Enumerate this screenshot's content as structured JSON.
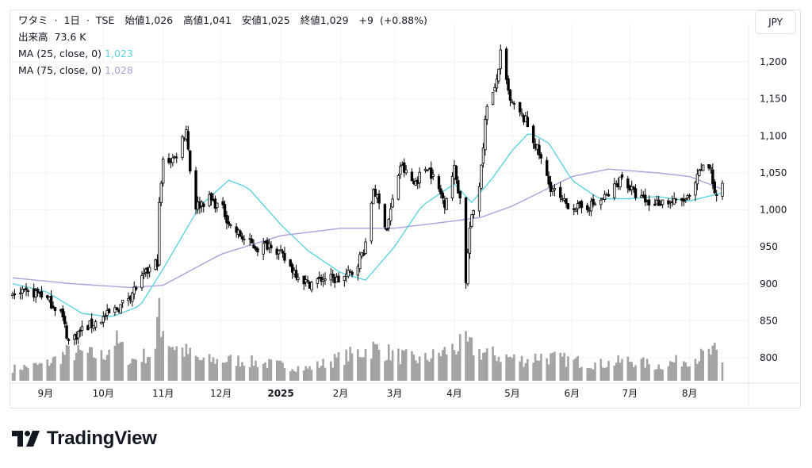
{
  "legend": {
    "name": "ワタミ",
    "interval": "1日",
    "exchange": "TSE",
    "sep": "·",
    "open_label": "始値",
    "open": "1,026",
    "high_label": "高値",
    "high": "1,041",
    "low_label": "安値",
    "low": "1,025",
    "close_label": "終値",
    "close": "1,029",
    "change": "+9",
    "change_pct": "(+0.88%)",
    "volume_label": "出来高",
    "volume": "73.6 K",
    "ma1_label": "MA (25, close, 0)",
    "ma1_value": "1,023",
    "ma2_label": "MA (75, close, 0)",
    "ma2_value": "1,028"
  },
  "currency": "JPY",
  "brand": "TradingView",
  "colors": {
    "up": "#ffffff",
    "down": "#000000",
    "wick": "#000000",
    "ma1": "#5fd3df",
    "ma2": "#b39ddb",
    "volume": "#a3a3a3",
    "grid": "#f2f3f5",
    "text": "#131722",
    "border": "#e0e3eb"
  },
  "chart_data": {
    "type": "candlestick",
    "title": "ワタミ · 1日 · TSE",
    "x_range": [
      "2024-08-15",
      "2025-08-18"
    ],
    "ylim": [
      775,
      1235
    ],
    "y_ticks": [
      800,
      850,
      900,
      950,
      1000,
      1050,
      1100,
      1150,
      1200
    ],
    "y_tick_labels": [
      "800",
      "850",
      "900",
      "950",
      "1,000",
      "1,050",
      "1,100",
      "1,150",
      "1,200"
    ],
    "x_ticks": [
      {
        "date": "2024-09-01",
        "label": "9月"
      },
      {
        "date": "2024-10-01",
        "label": "10月"
      },
      {
        "date": "2024-11-01",
        "label": "11月"
      },
      {
        "date": "2024-12-01",
        "label": "12月"
      },
      {
        "date": "2025-01-01",
        "label": "2025"
      },
      {
        "date": "2025-02-01",
        "label": "2月"
      },
      {
        "date": "2025-03-01",
        "label": "3月"
      },
      {
        "date": "2025-04-01",
        "label": "4月"
      },
      {
        "date": "2025-05-01",
        "label": "5月"
      },
      {
        "date": "2025-06-01",
        "label": "6月"
      },
      {
        "date": "2025-07-01",
        "label": "7月"
      },
      {
        "date": "2025-08-01",
        "label": "8月"
      }
    ],
    "close_anchors": [
      [
        "2024-08-15",
        885
      ],
      [
        "2024-08-29",
        888
      ],
      [
        "2024-09-09",
        862
      ],
      [
        "2024-09-13",
        822
      ],
      [
        "2024-09-20",
        838
      ],
      [
        "2024-09-30",
        852
      ],
      [
        "2024-10-10",
        870
      ],
      [
        "2024-10-18",
        895
      ],
      [
        "2024-10-25",
        920
      ],
      [
        "2024-10-29",
        930
      ],
      [
        "2024-10-30",
        1005
      ],
      [
        "2024-11-01",
        1065
      ],
      [
        "2024-11-07",
        1070
      ],
      [
        "2024-11-13",
        1110
      ],
      [
        "2024-11-15",
        1055
      ],
      [
        "2024-11-18",
        1005
      ],
      [
        "2024-11-25",
        1015
      ],
      [
        "2024-12-02",
        1000
      ],
      [
        "2024-12-06",
        978
      ],
      [
        "2024-12-13",
        960
      ],
      [
        "2024-12-20",
        948
      ],
      [
        "2024-12-27",
        955
      ],
      [
        "2025-01-07",
        920
      ],
      [
        "2025-01-15",
        900
      ],
      [
        "2025-01-24",
        908
      ],
      [
        "2025-01-31",
        905
      ],
      [
        "2025-02-07",
        915
      ],
      [
        "2025-02-14",
        950
      ],
      [
        "2025-02-18",
        1030
      ],
      [
        "2025-02-25",
        975
      ],
      [
        "2025-03-04",
        1060
      ],
      [
        "2025-03-11",
        1035
      ],
      [
        "2025-03-18",
        1060
      ],
      [
        "2025-03-27",
        1010
      ],
      [
        "2025-04-01",
        1055
      ],
      [
        "2025-04-04",
        1015
      ],
      [
        "2025-04-07",
        905
      ],
      [
        "2025-04-09",
        975
      ],
      [
        "2025-04-14",
        1035
      ],
      [
        "2025-04-18",
        1145
      ],
      [
        "2025-04-22",
        1160
      ],
      [
        "2025-04-25",
        1210
      ],
      [
        "2025-04-30",
        1145
      ],
      [
        "2025-05-08",
        1120
      ],
      [
        "2025-05-15",
        1075
      ],
      [
        "2025-05-20",
        1035
      ],
      [
        "2025-05-27",
        1010
      ],
      [
        "2025-06-05",
        1002
      ],
      [
        "2025-06-13",
        1008
      ],
      [
        "2025-06-20",
        1020
      ],
      [
        "2025-06-27",
        1045
      ],
      [
        "2025-07-03",
        1022
      ],
      [
        "2025-07-11",
        1008
      ],
      [
        "2025-07-18",
        1012
      ],
      [
        "2025-07-25",
        1010
      ],
      [
        "2025-08-01",
        1015
      ],
      [
        "2025-08-07",
        1055
      ],
      [
        "2025-08-12",
        1058
      ],
      [
        "2025-08-14",
        1020
      ],
      [
        "2025-08-18",
        1029
      ]
    ],
    "ma25": [
      [
        "2024-08-15",
        900
      ],
      [
        "2024-09-01",
        890
      ],
      [
        "2024-09-20",
        860
      ],
      [
        "2024-10-05",
        855
      ],
      [
        "2024-10-20",
        870
      ],
      [
        "2024-11-01",
        920
      ],
      [
        "2024-11-20",
        1005
      ],
      [
        "2024-12-05",
        1040
      ],
      [
        "2024-12-15",
        1030
      ],
      [
        "2025-01-01",
        980
      ],
      [
        "2025-01-15",
        945
      ],
      [
        "2025-02-01",
        915
      ],
      [
        "2025-02-14",
        905
      ],
      [
        "2025-03-01",
        950
      ],
      [
        "2025-03-15",
        1005
      ],
      [
        "2025-04-01",
        1035
      ],
      [
        "2025-04-10",
        1010
      ],
      [
        "2025-04-20",
        1040
      ],
      [
        "2025-05-01",
        1080
      ],
      [
        "2025-05-10",
        1105
      ],
      [
        "2025-05-20",
        1090
      ],
      [
        "2025-06-01",
        1040
      ],
      [
        "2025-06-15",
        1015
      ],
      [
        "2025-07-01",
        1015
      ],
      [
        "2025-07-15",
        1018
      ],
      [
        "2025-08-01",
        1012
      ],
      [
        "2025-08-18",
        1023
      ]
    ],
    "ma75": [
      [
        "2024-08-15",
        908
      ],
      [
        "2024-09-15",
        900
      ],
      [
        "2024-10-15",
        895
      ],
      [
        "2024-11-01",
        898
      ],
      [
        "2024-12-01",
        940
      ],
      [
        "2025-01-01",
        965
      ],
      [
        "2025-02-01",
        975
      ],
      [
        "2025-03-01",
        975
      ],
      [
        "2025-04-01",
        985
      ],
      [
        "2025-04-15",
        990
      ],
      [
        "2025-05-01",
        1005
      ],
      [
        "2025-06-01",
        1045
      ],
      [
        "2025-06-20",
        1055
      ],
      [
        "2025-07-15",
        1050
      ],
      [
        "2025-08-01",
        1045
      ],
      [
        "2025-08-18",
        1028
      ]
    ],
    "volume_relative": [
      [
        "2024-08-15",
        0.15
      ],
      [
        "2024-09-01",
        0.2
      ],
      [
        "2024-09-13",
        0.35
      ],
      [
        "2024-10-01",
        0.3
      ],
      [
        "2024-10-07",
        0.5
      ],
      [
        "2024-10-15",
        0.25
      ],
      [
        "2024-10-28",
        0.35
      ],
      [
        "2024-10-29",
        0.6
      ],
      [
        "2024-10-30",
        1.0
      ],
      [
        "2024-10-31",
        0.7
      ],
      [
        "2024-11-05",
        0.45
      ],
      [
        "2024-11-13",
        0.35
      ],
      [
        "2024-11-20",
        0.25
      ],
      [
        "2024-12-10",
        0.25
      ],
      [
        "2025-01-15",
        0.15
      ],
      [
        "2025-02-18",
        0.4
      ],
      [
        "2025-03-04",
        0.3
      ],
      [
        "2025-03-15",
        0.25
      ],
      [
        "2025-04-07",
        0.45
      ],
      [
        "2025-04-14",
        0.35
      ],
      [
        "2025-04-25",
        0.3
      ],
      [
        "2025-05-08",
        0.25
      ],
      [
        "2025-05-15",
        0.3
      ],
      [
        "2025-06-15",
        0.2
      ],
      [
        "2025-07-01",
        0.25
      ],
      [
        "2025-07-15",
        0.18
      ],
      [
        "2025-08-07",
        0.3
      ],
      [
        "2025-08-14",
        0.35
      ],
      [
        "2025-08-18",
        0.2
      ]
    ]
  }
}
